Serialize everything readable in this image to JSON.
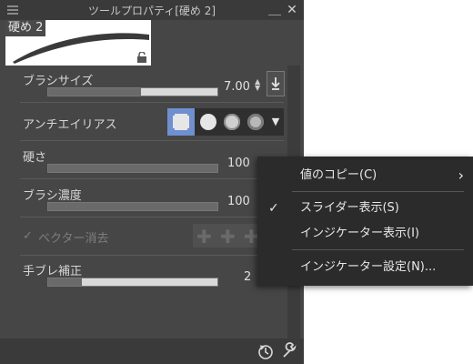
{
  "window": {
    "title": "ツールプロパティ[硬め 2]",
    "minimize_glyph": "＿",
    "close_glyph": "✕"
  },
  "preview": {
    "label": "硬め 2"
  },
  "properties": {
    "brush_size": {
      "label": "ブラシサイズ",
      "value": "7.00",
      "level": 0.55
    },
    "antialias": {
      "label": "アンチエイリアス",
      "selected_index": 0
    },
    "hardness": {
      "label": "硬さ",
      "value": "100",
      "level": 1.0
    },
    "density": {
      "label": "ブラシ濃度",
      "value": "100",
      "level": 1.0
    },
    "vector_erase": {
      "label": "ベクター消去",
      "checked": true,
      "enabled": false
    },
    "stabilization": {
      "label": "手ブレ補正",
      "value": "2",
      "level": 0.2
    }
  },
  "context_menu": {
    "items": [
      {
        "label": "値のコピー(C)",
        "has_submenu": true,
        "checked": false
      },
      {
        "label": "スライダー表示(S)",
        "has_submenu": false,
        "checked": true
      },
      {
        "label": "インジケーター表示(I)",
        "has_submenu": false,
        "checked": false
      },
      {
        "label": "インジケーター設定(N)...",
        "has_submenu": false,
        "checked": false
      }
    ],
    "check_glyph": "✓",
    "arrow_glyph": "›"
  },
  "icons": {
    "menu": "hamburger-icon",
    "lock": "lock-icon",
    "download": "download-icon",
    "reset": "reset-icon",
    "wrench": "wrench-icon"
  },
  "colors": {
    "panel": "#464646",
    "accent": "#6f8fd0",
    "menu_bg": "#2b2b2b"
  }
}
